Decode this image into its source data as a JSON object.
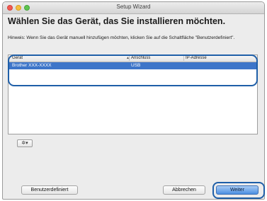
{
  "window": {
    "title": "Setup Wizard"
  },
  "heading": "Wählen Sie das Gerät, das Sie installieren möchten.",
  "hint": "Hinweis: Wenn Sie das Gerät manuell hinzufügen möchten, klicken Sie auf die Schaltfläche \"Benutzerdefiniert\".",
  "table": {
    "columns": [
      "Gerät",
      "Anschluss",
      "IP-Adresse"
    ],
    "rows": [
      {
        "device": "Brother XXX-XXXX",
        "connection": "USB",
        "ip": ""
      }
    ]
  },
  "gear_menu": {
    "icon": "gear-icon",
    "caret": "▾"
  },
  "buttons": {
    "custom": "Benutzerdefiniert",
    "cancel": "Abbrechen",
    "next": "Weiter"
  },
  "colors": {
    "selection": "#3d75c9",
    "highlight_ring": "#1f5fa8",
    "default_button": "#4c8fe2"
  }
}
